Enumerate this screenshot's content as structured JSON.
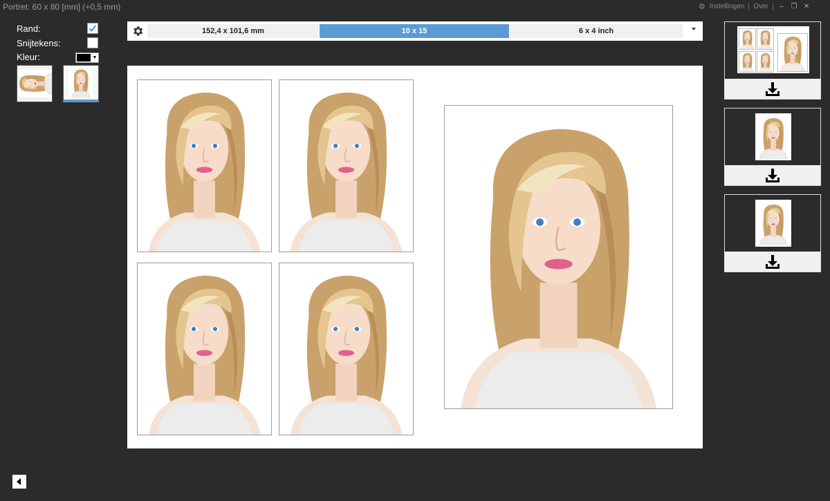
{
  "window": {
    "title": "Portret: 60 x 80 [mm] (+0,5 mm)",
    "settings_label": "Instellingen",
    "about_label": "Over"
  },
  "options": {
    "border_label": "Rand:",
    "border_checked": true,
    "cropmarks_label": "Snijtekens:",
    "cropmarks_checked": false,
    "color_label": "Kleur:",
    "color_value": "#000000"
  },
  "paper_sizes": {
    "items": [
      "152,4 x 101,6 mm",
      "10 x 15",
      "6 x 4 inch"
    ],
    "selected": "10 x 15"
  },
  "icons": {
    "settings": "gear-icon",
    "download": "download-icon",
    "back": "triangle-left-icon",
    "dropdown": "chevron-down-icon"
  },
  "colors": {
    "accent": "#5b9bd5",
    "background": "#2b2b2b"
  }
}
